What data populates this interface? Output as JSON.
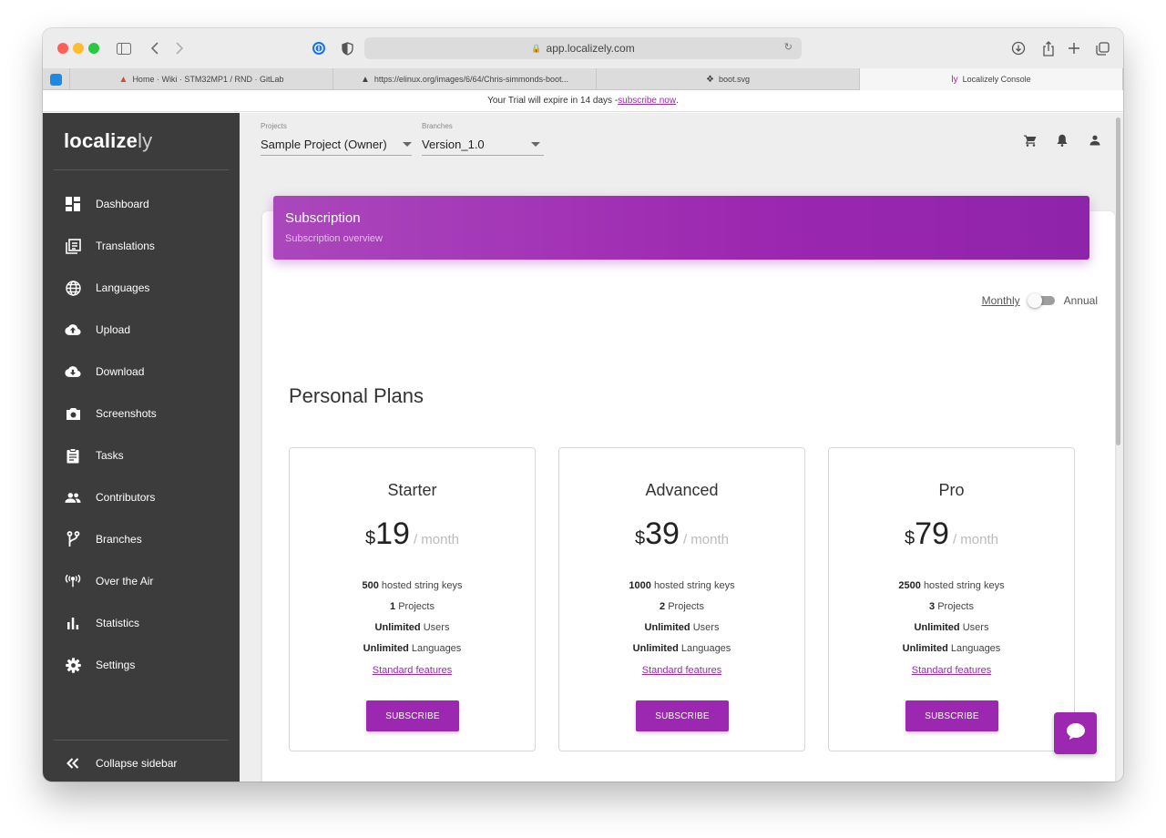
{
  "browser": {
    "url": "app.localizely.com",
    "tabs": [
      {
        "label": "Home · Wiki · STM32MP1 / RND · GitLab",
        "icon": "gitlab-icon"
      },
      {
        "label": "https://elinux.org/images/6/64/Chris-simmonds-boot...",
        "icon": "tux-icon"
      },
      {
        "label": "boot.svg",
        "icon": "compass-icon"
      },
      {
        "label": "Localizely Console",
        "icon": "localizely-icon"
      }
    ]
  },
  "trial": {
    "text": "Your Trial will expire in 14 days - ",
    "link": "subscribe now",
    "suffix": "."
  },
  "sidebar": {
    "logo_bold": "localize",
    "logo_light": "ly",
    "items": [
      {
        "label": "Dashboard",
        "icon": "dashboard-icon"
      },
      {
        "label": "Translations",
        "icon": "translations-icon"
      },
      {
        "label": "Languages",
        "icon": "globe-icon"
      },
      {
        "label": "Upload",
        "icon": "cloud-upload-icon"
      },
      {
        "label": "Download",
        "icon": "cloud-download-icon"
      },
      {
        "label": "Screenshots",
        "icon": "camera-icon"
      },
      {
        "label": "Tasks",
        "icon": "clipboard-icon"
      },
      {
        "label": "Contributors",
        "icon": "people-icon"
      },
      {
        "label": "Branches",
        "icon": "branch-icon"
      },
      {
        "label": "Over the Air",
        "icon": "antenna-icon"
      },
      {
        "label": "Statistics",
        "icon": "bar-chart-icon"
      },
      {
        "label": "Settings",
        "icon": "gear-icon"
      }
    ],
    "collapse_label": "Collapse sidebar"
  },
  "topbar": {
    "projects_label": "Projects",
    "projects_value": "Sample Project (Owner)",
    "branches_label": "Branches",
    "branches_value": "Version_1.0"
  },
  "subscription": {
    "title": "Subscription",
    "subtitle": "Subscription overview",
    "toggle_monthly": "Monthly",
    "toggle_annual": "Annual",
    "section_title": "Personal Plans",
    "currency": "$",
    "period": "/ month",
    "subscribe_label": "SUBSCRIBE",
    "features_link": "Standard features",
    "plans": [
      {
        "name": "Starter",
        "price": "19",
        "keys": "500",
        "keys_label": "hosted string keys",
        "projects": "1",
        "projects_label": "Projects",
        "users": "Unlimited",
        "users_label": "Users",
        "languages": "Unlimited",
        "languages_label": "Languages"
      },
      {
        "name": "Advanced",
        "price": "39",
        "keys": "1000",
        "keys_label": "hosted string keys",
        "projects": "2",
        "projects_label": "Projects",
        "users": "Unlimited",
        "users_label": "Users",
        "languages": "Unlimited",
        "languages_label": "Languages"
      },
      {
        "name": "Pro",
        "price": "79",
        "keys": "2500",
        "keys_label": "hosted string keys",
        "projects": "3",
        "projects_label": "Projects",
        "users": "Unlimited",
        "users_label": "Users",
        "languages": "Unlimited",
        "languages_label": "Languages"
      }
    ]
  },
  "colors": {
    "accent": "#9c27b0",
    "sidebar_bg": "#3c3c3c"
  }
}
